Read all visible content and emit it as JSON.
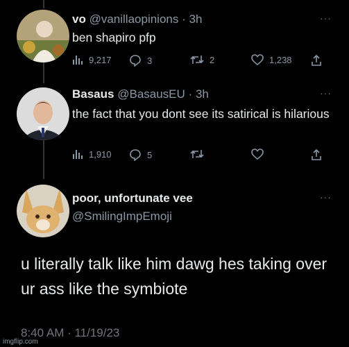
{
  "tweet1": {
    "display_name": "vo",
    "handle": "@vanillaopinions",
    "separator": "·",
    "time": "3h",
    "text": "ben shapiro pfp",
    "views": "9,217",
    "replies": "3",
    "retweets": "2",
    "likes": "1,238",
    "more": "···"
  },
  "tweet2": {
    "display_name": "Basaus",
    "handle": "@BasausEU",
    "separator": "·",
    "time": "3h",
    "text": "the fact that you dont see its satirical is hilarious",
    "views": "1,910",
    "replies": "5",
    "more": "···"
  },
  "main_tweet": {
    "display_name": "poor, unfortunate vee",
    "handle": "@SmilingImpEmoji",
    "text": "u literally talk like him dawg hes taking over ur ass like the symbiote",
    "timestamp": "8:40 AM · 11/19/23",
    "more": "···"
  },
  "watermark": "imgflip.com",
  "icons": [
    "views-icon",
    "reply-icon",
    "retweet-icon",
    "like-icon",
    "share-icon"
  ],
  "colors": {
    "background": "#000000",
    "text": "#e7e9ea",
    "muted": "#8b98a5"
  }
}
